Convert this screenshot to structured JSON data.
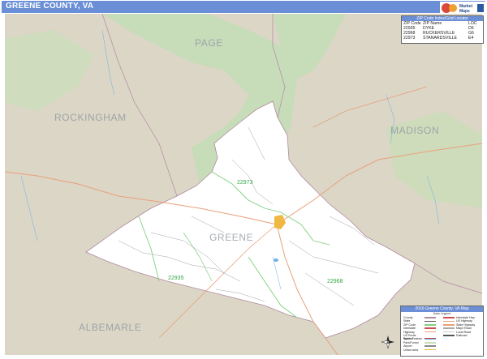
{
  "title": "GREENE COUNTY, VA",
  "logo": {
    "text": "Market Maps",
    "icon": "mapsales-logo"
  },
  "counties": {
    "page": "PAGE",
    "rockingham": "ROCKINGHAM",
    "madison": "MADISON",
    "greene": "GREENE",
    "albemarle": "ALBEMARLE"
  },
  "zip_labels": [
    "22973",
    "22935",
    "22968"
  ],
  "zip_locator": {
    "title": "ZIP Code Index/Grid Locator",
    "headers": [
      "ZIP Code",
      "ZIP Name",
      "LOC"
    ],
    "rows": [
      [
        "22935",
        "DYKE",
        "D6"
      ],
      [
        "22968",
        "RUCKERSVILLE",
        "G6"
      ],
      [
        "22973",
        "STANARDSVILLE",
        "E4"
      ]
    ]
  },
  "legend": {
    "title": "2016 Greene County, VA Map",
    "subtitle": "Data Legend",
    "items_left": [
      "County",
      "State",
      "ZIP Code",
      "Interstate",
      "Highway",
      "US Route Symbol",
      "Water Feature",
      "Park/Forest",
      "Airport",
      "Urban Area"
    ],
    "items_right": [
      "Interstate Hwy",
      "US Highway",
      "State Highway",
      "Major Road",
      "Local Road",
      "Railroad"
    ]
  },
  "compass_icon": "north-arrow-icon",
  "colors": {
    "title_bar": "#6b8fd6",
    "outside_land": "#dcd6c6",
    "forest": "#c7dcb8",
    "county_fill": "#ffffff",
    "zip_boundary": "#7fd07f",
    "county_boundary": "#b08aa0",
    "major_road": "#e8a07a",
    "water": "#6ab0e6",
    "urban": "#f0b840"
  }
}
